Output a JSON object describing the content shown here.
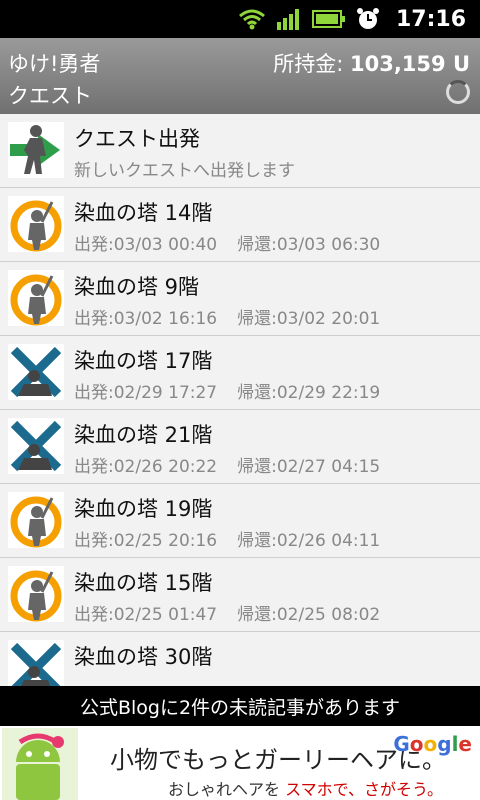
{
  "status_bar": {
    "time": "17:16"
  },
  "header": {
    "app_title": "ゆけ!勇者",
    "screen_title": "クエスト",
    "money_label": "所持金:",
    "money_value": "103,159 U"
  },
  "depart_item": {
    "title": "クエスト出発",
    "subtitle": "新しいクエストへ出発します",
    "icon": "hero-depart-arrow-icon"
  },
  "quests": [
    {
      "name": "染血の塔 14階",
      "depart": "出発:03/03 00:40",
      "return": "帰還:03/03 06:30",
      "icon": "hero-in-progress-icon"
    },
    {
      "name": "染血の塔 9階",
      "depart": "出発:03/02 16:16",
      "return": "帰還:03/02 20:01",
      "icon": "hero-in-progress-icon"
    },
    {
      "name": "染血の塔 17階",
      "depart": "出発:02/29 17:27",
      "return": "帰還:02/29 22:19",
      "icon": "hero-failed-icon"
    },
    {
      "name": "染血の塔 21階",
      "depart": "出発:02/26 20:22",
      "return": "帰還:02/27 04:15",
      "icon": "hero-failed-icon"
    },
    {
      "name": "染血の塔 19階",
      "depart": "出発:02/25 20:16",
      "return": "帰還:02/26 04:11",
      "icon": "hero-in-progress-icon"
    },
    {
      "name": "染血の塔 15階",
      "depart": "出発:02/25 01:47",
      "return": "帰還:02/25 08:02",
      "icon": "hero-in-progress-icon"
    },
    {
      "name": "染血の塔 30階",
      "depart": "",
      "return": "",
      "icon": "hero-failed-icon"
    }
  ],
  "blog_notice": "公式Blogに2件の未読記事があります",
  "ad": {
    "headline": "小物でもっとガーリーヘアに。",
    "sub_a": "おしゃれヘアを",
    "sub_b": "スマホで、さがそう。",
    "brand": "Google"
  },
  "colors": {
    "orange": "#f5a000",
    "teal": "#1c6b8f",
    "green": "#2e9e4a"
  }
}
